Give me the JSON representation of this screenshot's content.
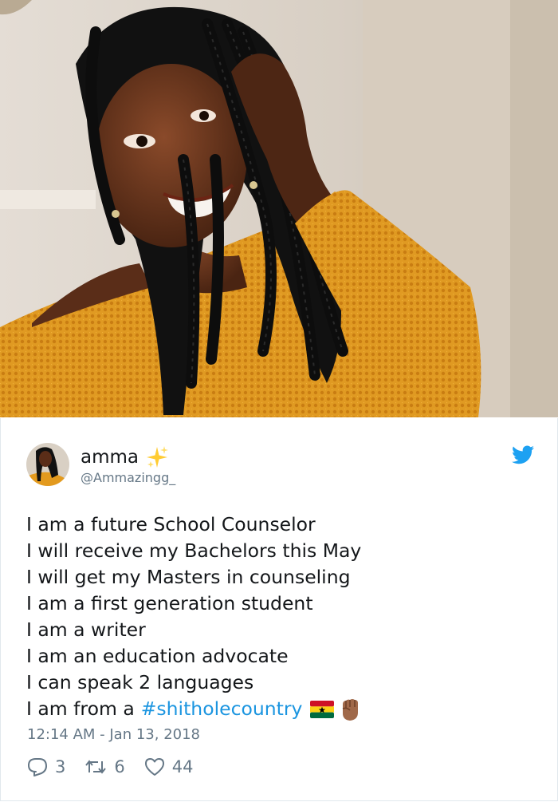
{
  "photo": {
    "subject": "selfie-photo"
  },
  "tweet": {
    "display_name": "amma",
    "handle": "@Ammazingg_",
    "lines": [
      "I am a future School Counselor",
      "I will receive my Bachelors this May",
      "I will get my Masters in counseling",
      "I am a first generation student",
      "I am a writer",
      "I am an education advocate",
      "I can speak 2 languages",
      "I am from a"
    ],
    "hashtag": "#shitholecountry",
    "timestamp": "12:14 AM - Jan 13, 2018",
    "stats": {
      "replies": "3",
      "retweets": "6",
      "likes": "44"
    }
  },
  "icons": {
    "sparkle": "sparkles-icon",
    "bird": "twitter-bird-icon",
    "flag": "ghana-flag-icon",
    "fist": "raised-fist-icon",
    "reply": "reply-icon",
    "retweet": "retweet-icon",
    "like": "heart-icon"
  },
  "colors": {
    "link": "#1b95e0",
    "secondary_text": "#657786",
    "primary_text": "#14171a",
    "sweater": "#e39a1e"
  }
}
